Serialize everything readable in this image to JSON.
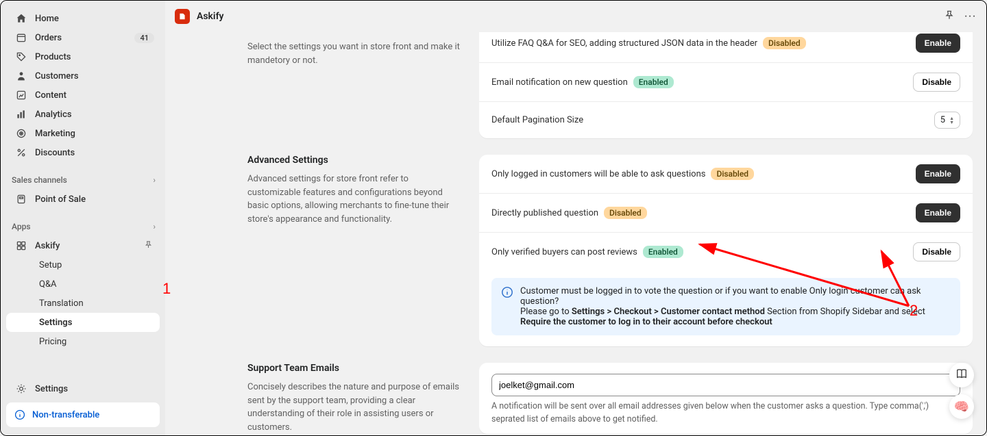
{
  "app": {
    "title": "Askify"
  },
  "sidebar": {
    "home": "Home",
    "orders": "Orders",
    "orders_badge": "41",
    "products": "Products",
    "customers": "Customers",
    "content": "Content",
    "analytics": "Analytics",
    "marketing": "Marketing",
    "discounts": "Discounts",
    "sales_channels": "Sales channels",
    "pos": "Point of Sale",
    "apps_header": "Apps",
    "askify": "Askify",
    "setup": "Setup",
    "qa": "Q&A",
    "translation": "Translation",
    "settings": "Settings",
    "pricing": "Pricing",
    "global_settings": "Settings",
    "non_transferable": "Non-transferable"
  },
  "top_section": {
    "desc": "Select the settings you want in store front and make it mandetory or not.",
    "seo_row": "Utilize FAQ Q&A for SEO, adding structured JSON data in the header",
    "seo_badge": "Disabled",
    "seo_btn": "Enable",
    "email_row": "Email notification on new question",
    "email_badge": "Enabled",
    "email_btn": "Disable",
    "pagination": "Default Pagination Size",
    "pagination_val": "5"
  },
  "advanced": {
    "title": "Advanced Settings",
    "desc": "Advanced settings for store front refer to customizable features and configurations beyond basic options, allowing merchants to fine-tune their store's appearance and functionality.",
    "logged_in": "Only logged in customers will be able to ask questions",
    "logged_in_badge": "Disabled",
    "logged_in_btn": "Enable",
    "direct_pub": "Directly published question",
    "direct_pub_badge": "Disabled",
    "direct_pub_btn": "Enable",
    "verified": "Only verified buyers can post reviews",
    "verified_badge": "Enabled",
    "verified_btn": "Disable",
    "info_line1": "Customer must be logged in to vote the question or if you want to enable Only login customer can ask question?",
    "info_line2a": "Please go to ",
    "info_line2b": "Settings > Checkout > Customer contact method",
    "info_line2c": " Section from Shopify Sidebar and select ",
    "info_line2d": "Require the customer to log in to their account before checkout"
  },
  "support": {
    "title": "Support Team Emails",
    "desc": "Concisely describes the nature and purpose of emails sent by the support team, providing a clear understanding of their role in assisting users or customers.",
    "email": "joelket@gmail.com",
    "note": "A notification will be sent over all email addresses given below when the customer asks a question. Type comma(',') seprated list of emails above to get notified."
  },
  "annotations": {
    "one": "1",
    "two": "2"
  }
}
